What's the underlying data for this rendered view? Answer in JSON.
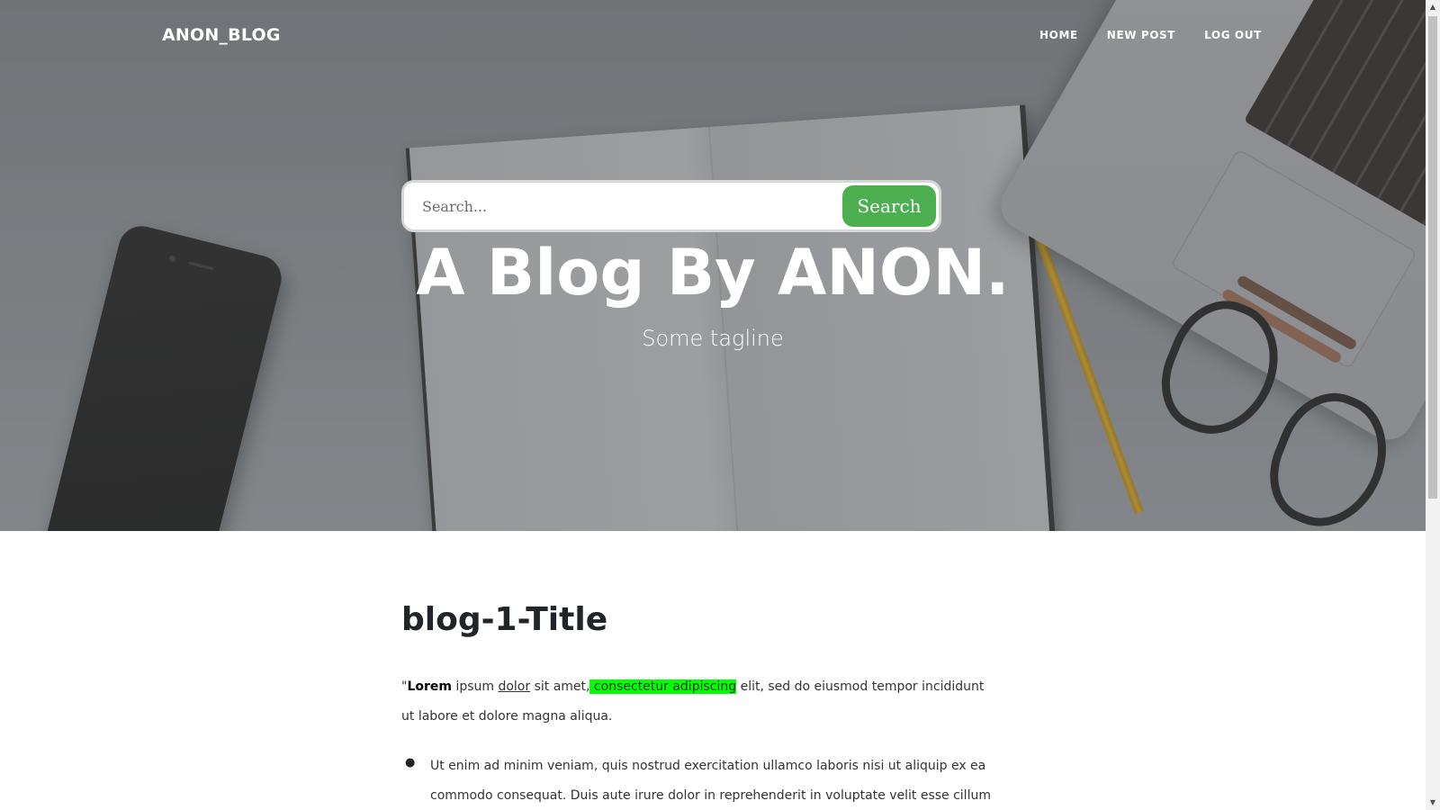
{
  "nav": {
    "brand": "ANON_BLOG",
    "links": [
      "HOME",
      "NEW POST",
      "LOG OUT"
    ]
  },
  "search": {
    "placeholder": "Search...",
    "button_label": "Search"
  },
  "hero": {
    "title": "A Blog By ANON.",
    "subtitle": "Some tagline"
  },
  "post": {
    "title": "blog-1-Title",
    "paragraph": {
      "quote_mark": "\"",
      "bold": "Lorem",
      "text1": " ipsum ",
      "underlined": "dolor",
      "text2": " sit amet,",
      "highlighted": " consectetur adipiscing",
      "text3": " elit, sed do eiusmod tempor incididunt ut labore et dolore magna aliqua."
    },
    "list_items": [
      "Ut enim ad minim veniam, quis nostrud exercitation ullamco laboris nisi ut aliquip ex ea commodo consequat. Duis aute irure dolor in reprehenderit in voluptate velit esse cillum dolore eu fugiat nulla"
    ]
  },
  "scrollbar": {
    "arrow_up": "▲",
    "arrow_down": "▼"
  },
  "colors": {
    "search_button": "#4caf50",
    "highlight": "#00ff00"
  }
}
